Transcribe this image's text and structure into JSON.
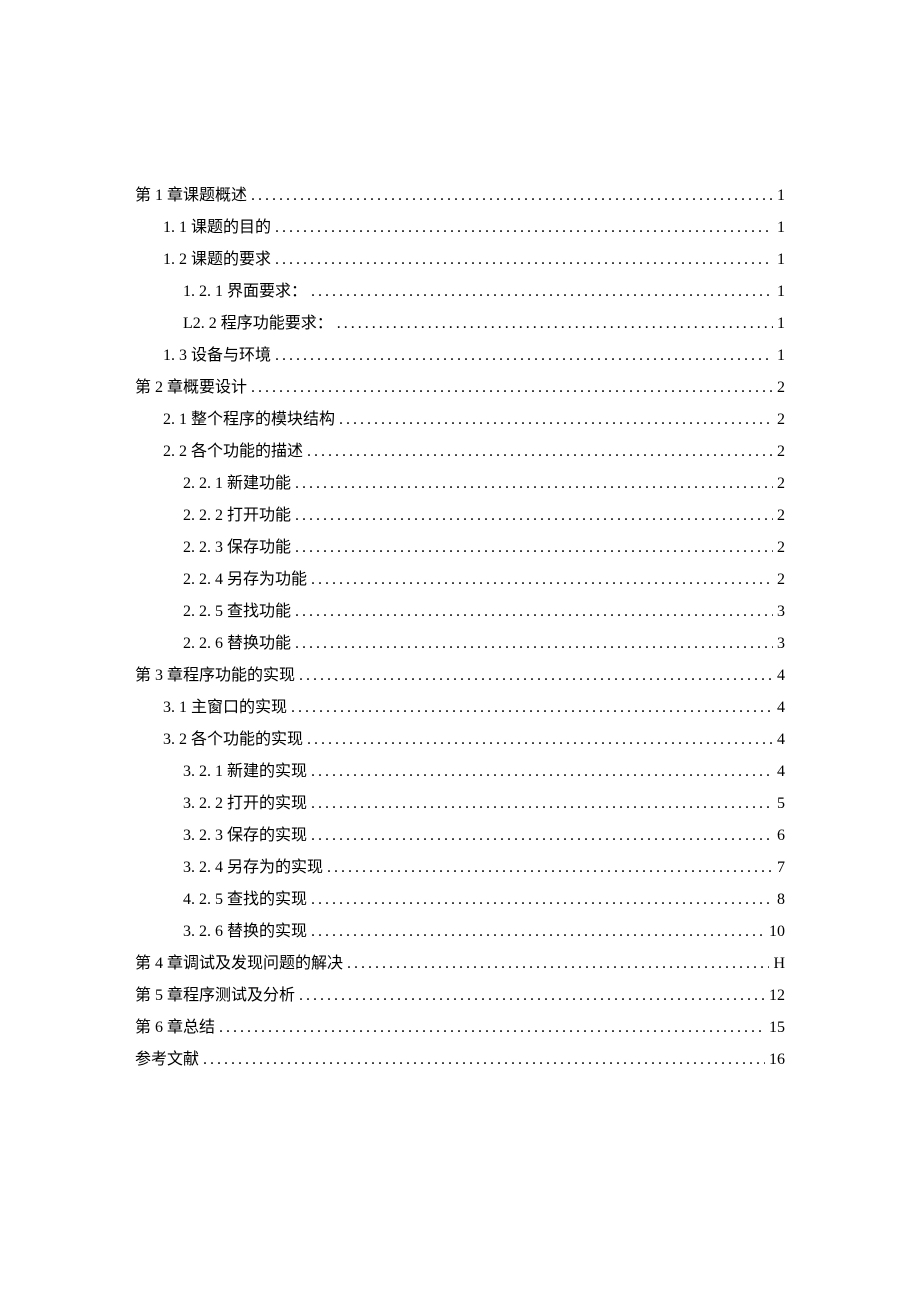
{
  "toc": [
    {
      "title": "第 1 章课题概述",
      "page": "1",
      "level": 0
    },
    {
      "title": "1. 1  课题的目的",
      "page": "1",
      "level": 1
    },
    {
      "title": "1. 2  课题的要求",
      "page": "1",
      "level": 1
    },
    {
      "title": "1. 2. 1 界面要求：",
      "page": "1",
      "level": 2
    },
    {
      "title": "L2. 2 程序功能要求：",
      "page": "1",
      "level": 2
    },
    {
      "title": "1. 3 设备与环境",
      "page": "1",
      "level": 1
    },
    {
      "title": "第 2 章概要设计",
      "page": "2",
      "level": 0
    },
    {
      "title": "2. 1   整个程序的模块结构",
      "page": "2",
      "level": 1
    },
    {
      "title": "2. 2   各个功能的描述",
      "page": "2",
      "level": 1
    },
    {
      "title": "2. 2. 1 新建功能",
      "page": "2",
      "level": 2
    },
    {
      "title": "2. 2. 2 打开功能",
      "page": "2",
      "level": 2
    },
    {
      "title": "2. 2. 3 保存功能",
      "page": "2",
      "level": 2
    },
    {
      "title": "2. 2. 4 另存为功能",
      "page": "2",
      "level": 2
    },
    {
      "title": "2. 2. 5 查找功能",
      "page": "3",
      "level": 2
    },
    {
      "title": "2.   2. 6 替换功能",
      "page": "3",
      "level": 2
    },
    {
      "title": "第 3 章程序功能的实现",
      "page": "4",
      "level": 0
    },
    {
      "title": "3. 1 主窗口的实现",
      "page": "4",
      "level": 1
    },
    {
      "title": "3.   2 各个功能的实现",
      "page": "4",
      "level": 1
    },
    {
      "title": "3.   2. 1 新建的实现",
      "page": "4",
      "level": 2
    },
    {
      "title": "3.   2. 2 打开的实现",
      "page": "5",
      "level": 2
    },
    {
      "title": "3.   2. 3 保存的实现",
      "page": "6",
      "level": 2
    },
    {
      "title": "3.   2. 4 另存为的实现",
      "page": "7",
      "level": 2
    },
    {
      "title": "4.   2. 5 查找的实现",
      "page": "8",
      "level": 2
    },
    {
      "title": "3. 2. 6 替换的实现",
      "page": "10",
      "level": 2
    },
    {
      "title": "第 4 章调试及发现问题的解决",
      "page": "H",
      "level": 0
    },
    {
      "title": "第 5 章程序测试及分析",
      "page": "12",
      "level": 0
    },
    {
      "title": "第 6 章总结",
      "page": "15",
      "level": 0
    },
    {
      "title": "参考文献",
      "page": "16",
      "level": 0
    }
  ]
}
